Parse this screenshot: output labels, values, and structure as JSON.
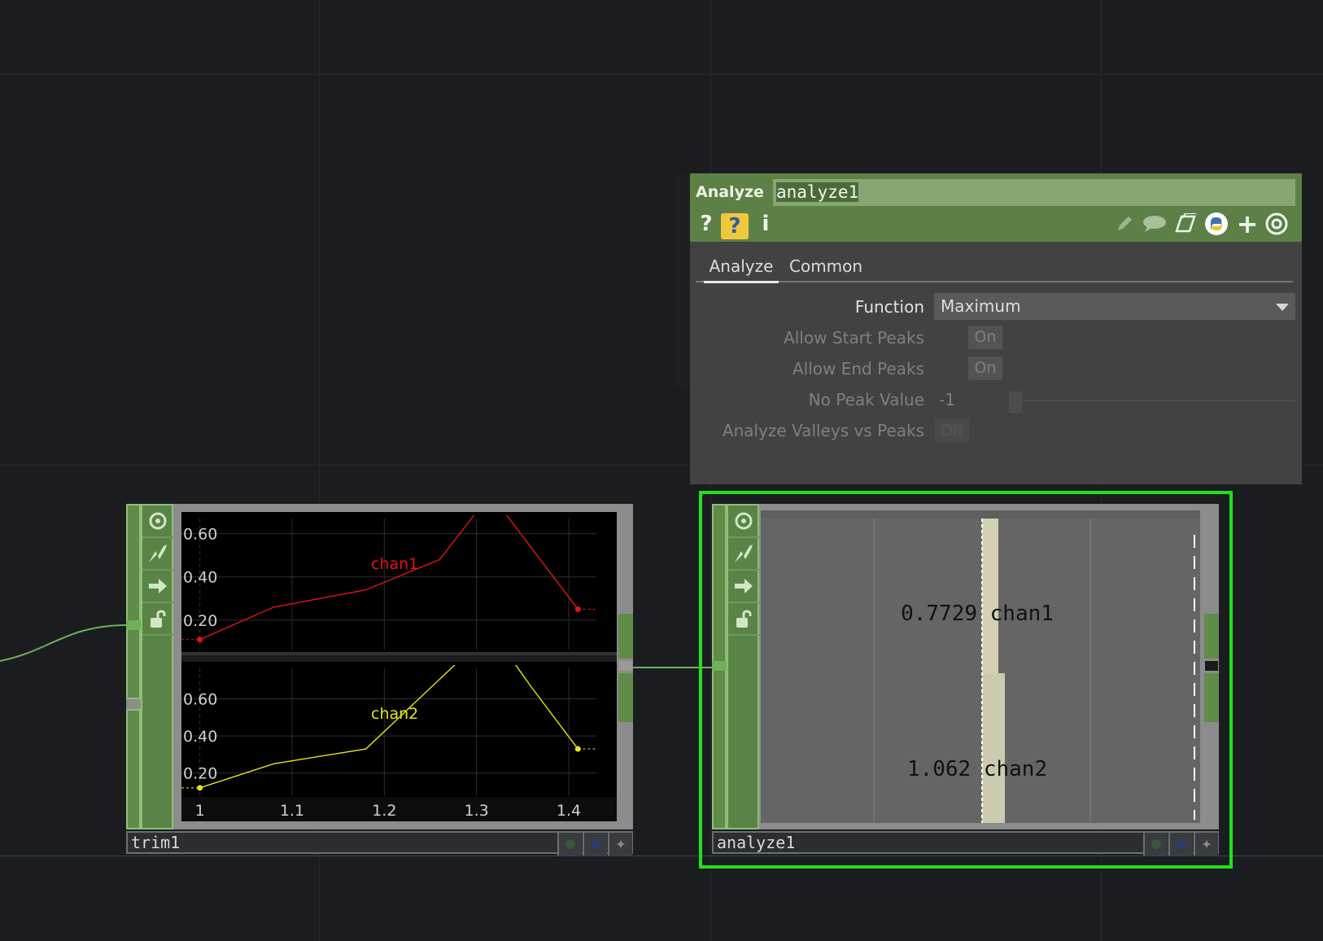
{
  "panel": {
    "type_label": "Analyze",
    "name": "analyze1",
    "icons": [
      "help-icon",
      "python-help-icon",
      "info-icon",
      "edit-icon",
      "comment-icon",
      "clone-icon",
      "python-icon",
      "add-icon",
      "viewer-target-icon"
    ],
    "tabs": [
      {
        "label": "Analyze",
        "active": true
      },
      {
        "label": "Common",
        "active": false
      }
    ],
    "params": {
      "function_label": "Function",
      "function_value": "Maximum",
      "allow_start_label": "Allow Start Peaks",
      "allow_start_value": "On",
      "allow_end_label": "Allow End Peaks",
      "allow_end_value": "On",
      "no_peak_label": "No Peak Value",
      "no_peak_value": "-1",
      "valleys_label": "Analyze Valleys vs Peaks",
      "valleys_value": "Off"
    }
  },
  "nodes": {
    "trim": {
      "name": "trim1",
      "chart_data": [
        {
          "type": "line",
          "series": [
            {
              "name": "chan1",
              "color": "#e01515"
            }
          ],
          "x": [
            1.0,
            1.08,
            1.18,
            1.26,
            1.3,
            1.33,
            1.41
          ],
          "values": [
            0.11,
            0.26,
            0.34,
            0.48,
            0.7,
            0.7,
            0.25
          ],
          "xlim": [
            0.98,
            1.43
          ],
          "ylim": [
            0.06,
            0.7
          ],
          "yticks": [
            "0.60",
            "0.40",
            "0.20"
          ],
          "grid": true
        },
        {
          "type": "line",
          "series": [
            {
              "name": "chan2",
              "color": "#e5e51a"
            }
          ],
          "x": [
            1.0,
            1.08,
            1.18,
            1.28,
            1.34,
            1.36,
            1.41
          ],
          "values": [
            0.12,
            0.25,
            0.33,
            0.8,
            0.8,
            0.66,
            0.33
          ],
          "xlim": [
            0.98,
            1.43
          ],
          "ylim": [
            0.08,
            0.8
          ],
          "yticks": [
            "0.60",
            "0.40",
            "0.20"
          ],
          "xticks": [
            "1",
            "1.1",
            "1.2",
            "1.3",
            "1.4"
          ],
          "grid": true
        }
      ]
    },
    "analyze": {
      "name": "analyze1",
      "chart_data": {
        "type": "bar",
        "series": [
          {
            "name": "chan1",
            "value": "0.7729"
          },
          {
            "name": "chan2",
            "value": "1.062"
          }
        ]
      }
    }
  },
  "colors": {
    "background": "#1b1c20",
    "node_green": "#5f8c49",
    "selection": "#1fe11f",
    "chan1": "#e01515",
    "chan2": "#e5e51a"
  }
}
